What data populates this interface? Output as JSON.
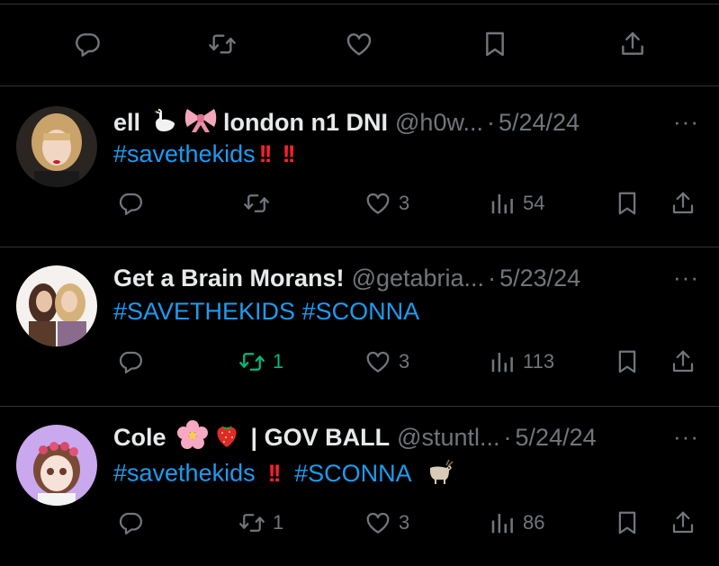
{
  "colors": {
    "background": "#000000",
    "text": "#e7e9ea",
    "muted": "#71767b",
    "link": "#1d9bf0",
    "retweeted": "#00ba7c",
    "alert": "#f4212e"
  },
  "top_actions": [
    "reply-icon",
    "retweet-icon",
    "like-icon",
    "bookmark-icon",
    "share-icon"
  ],
  "tweets": [
    {
      "name": "ell",
      "name_suffix": "london n1 DNI",
      "handle": "@h0w...",
      "date": "5/24/24",
      "tags": [
        "#savethekids"
      ],
      "reply_count": "",
      "retweet_count": "",
      "like_count": "3",
      "view_count": "54"
    },
    {
      "name": "Get a Brain Morans!",
      "handle": "@getabria...",
      "date": "5/23/24",
      "tags": [
        "#SAVETHEKIDS",
        "#SCONNA"
      ],
      "reply_count": "",
      "retweet_count": "1",
      "like_count": "3",
      "view_count": "113"
    },
    {
      "name": "Cole",
      "name_suffix": "| GOV BALL",
      "handle": "@stuntl...",
      "date": "5/24/24",
      "tags": [
        "#savethekids",
        "#SCONNA"
      ],
      "reply_count": "",
      "retweet_count": "1",
      "like_count": "3",
      "view_count": "86"
    }
  ],
  "dot": "·",
  "more": "···"
}
